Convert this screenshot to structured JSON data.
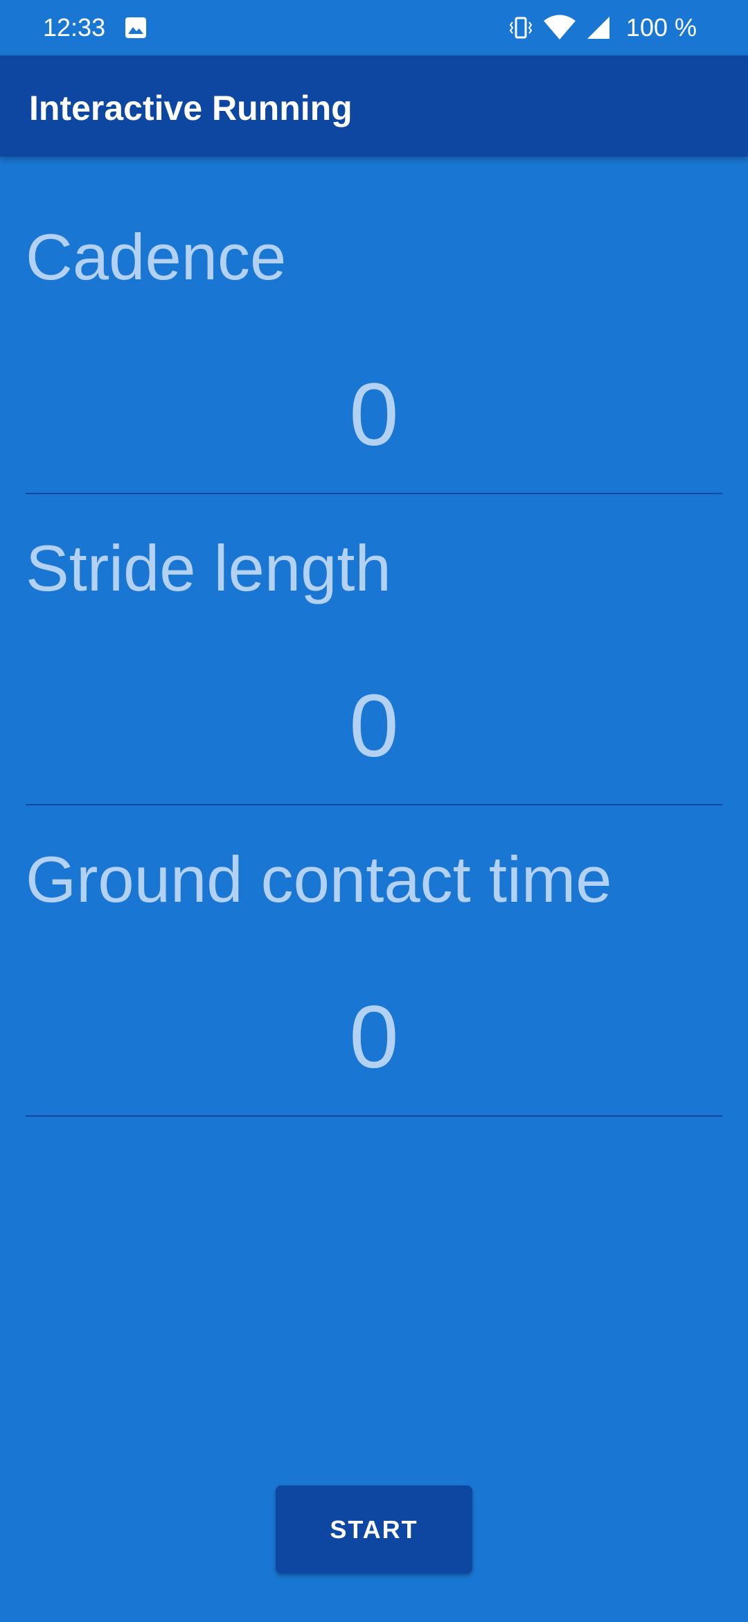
{
  "status_bar": {
    "time": "12:33",
    "battery": "100 %",
    "icons": [
      "gallery-icon",
      "vibrate-icon",
      "wifi-icon",
      "signal-icon"
    ]
  },
  "app_bar": {
    "title": "Interactive Running"
  },
  "metrics": [
    {
      "label": "Cadence",
      "value": "0"
    },
    {
      "label": "Stride length",
      "value": "0"
    },
    {
      "label": "Ground contact time",
      "value": "0"
    }
  ],
  "start_button": {
    "label": "START"
  },
  "colors": {
    "background": "#1976d2",
    "app_bar": "#0d47a1",
    "text_light": "#b3d1f2",
    "button": "#0d47a1"
  }
}
